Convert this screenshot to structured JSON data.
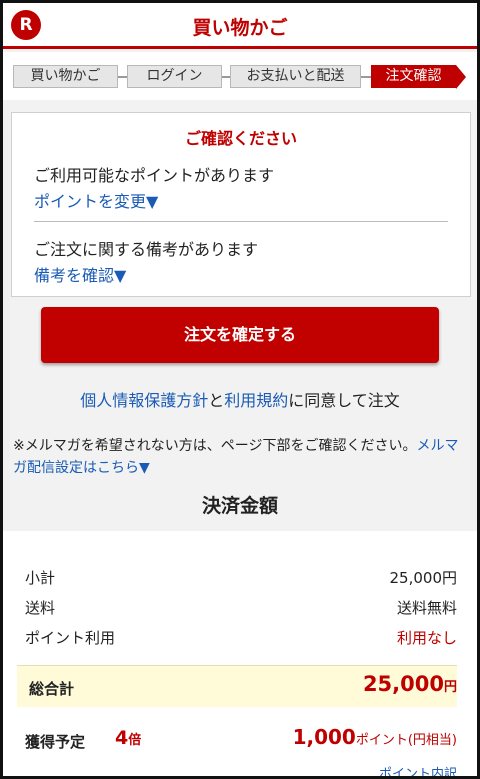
{
  "header": {
    "logo_letter": "R",
    "title": "買い物かご"
  },
  "steps": [
    {
      "label": "買い物かご"
    },
    {
      "label": "ログイン"
    },
    {
      "label": "お支払いと配送"
    },
    {
      "label": "注文確認"
    }
  ],
  "confirm": {
    "title": "ご確認ください",
    "points_notice": "ご利用可能なポイントがあります",
    "points_link": "ポイントを変更▼",
    "remarks_notice": "ご注文に関する備考があります",
    "remarks_link": "備考を確認▼"
  },
  "order_button_label": "注文を確定する",
  "agree": {
    "privacy_link": "個人情報保護方針",
    "and": "と",
    "terms_link": "利用規約",
    "suffix": "に同意して注文"
  },
  "mail_note": {
    "text": "※メルマガを希望されない方は、ページ下部をご確認ください。",
    "link": "メルマガ配信設定はこちら▼"
  },
  "payment": {
    "title": "決済金額",
    "rows": [
      {
        "label": "小計",
        "value": "25,000円"
      },
      {
        "label": "送料",
        "value": "送料無料"
      },
      {
        "label": "ポイント利用",
        "value": "利用なし"
      }
    ],
    "total_label": "総合計",
    "total_value": "25,000",
    "total_unit": "円",
    "earn_label": "獲得予定",
    "earn_multiplier": "4",
    "earn_multiplier_unit": "倍",
    "earn_points": "1,000",
    "earn_points_unit": "ポイント(円相当)",
    "points_detail_link": "ポイント内訳"
  },
  "colors": {
    "brand_red": "#bf0000",
    "link_blue": "#1a5bb5",
    "total_highlight": "#fffbd9"
  }
}
